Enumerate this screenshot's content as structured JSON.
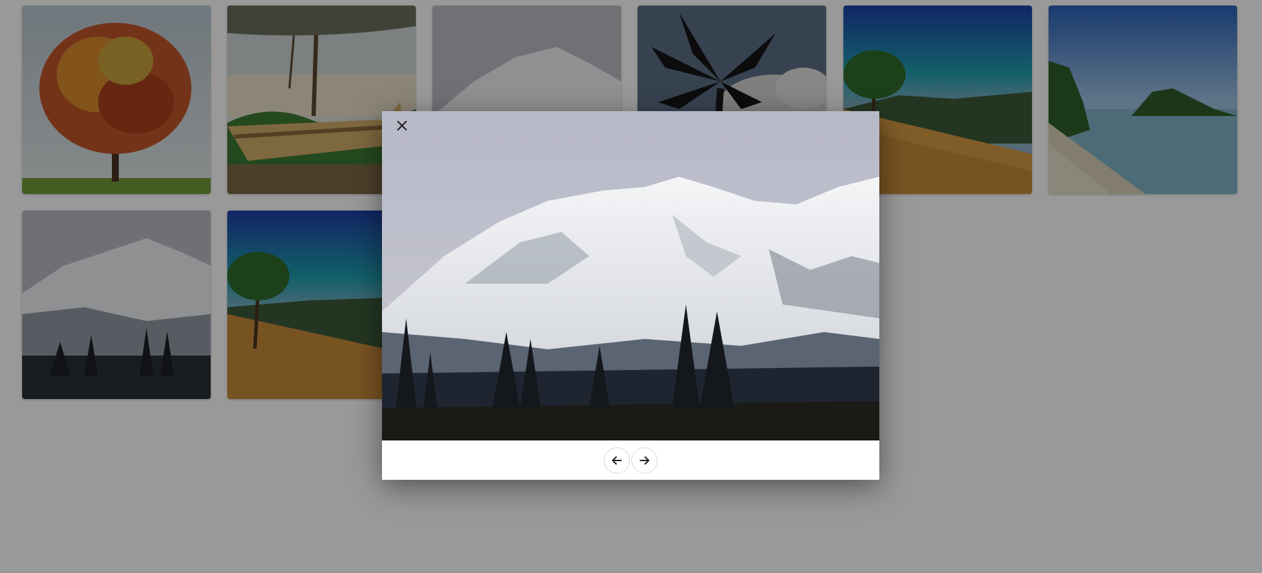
{
  "gallery": {
    "thumbnails": [
      {
        "subject": "autumn-tree"
      },
      {
        "subject": "beach-boat"
      },
      {
        "subject": "snowy-mountain"
      },
      {
        "subject": "palm-tree"
      },
      {
        "subject": "grassy-hill"
      },
      {
        "subject": "island-beach"
      },
      {
        "subject": "snowy-mountain"
      },
      {
        "subject": "grassy-hill"
      }
    ]
  },
  "lightbox": {
    "image_subject": "snowy-mountain",
    "close_icon": "close-icon",
    "prev_icon": "arrow-left-icon",
    "next_icon": "arrow-right-icon",
    "overlay_color": "#000000"
  }
}
